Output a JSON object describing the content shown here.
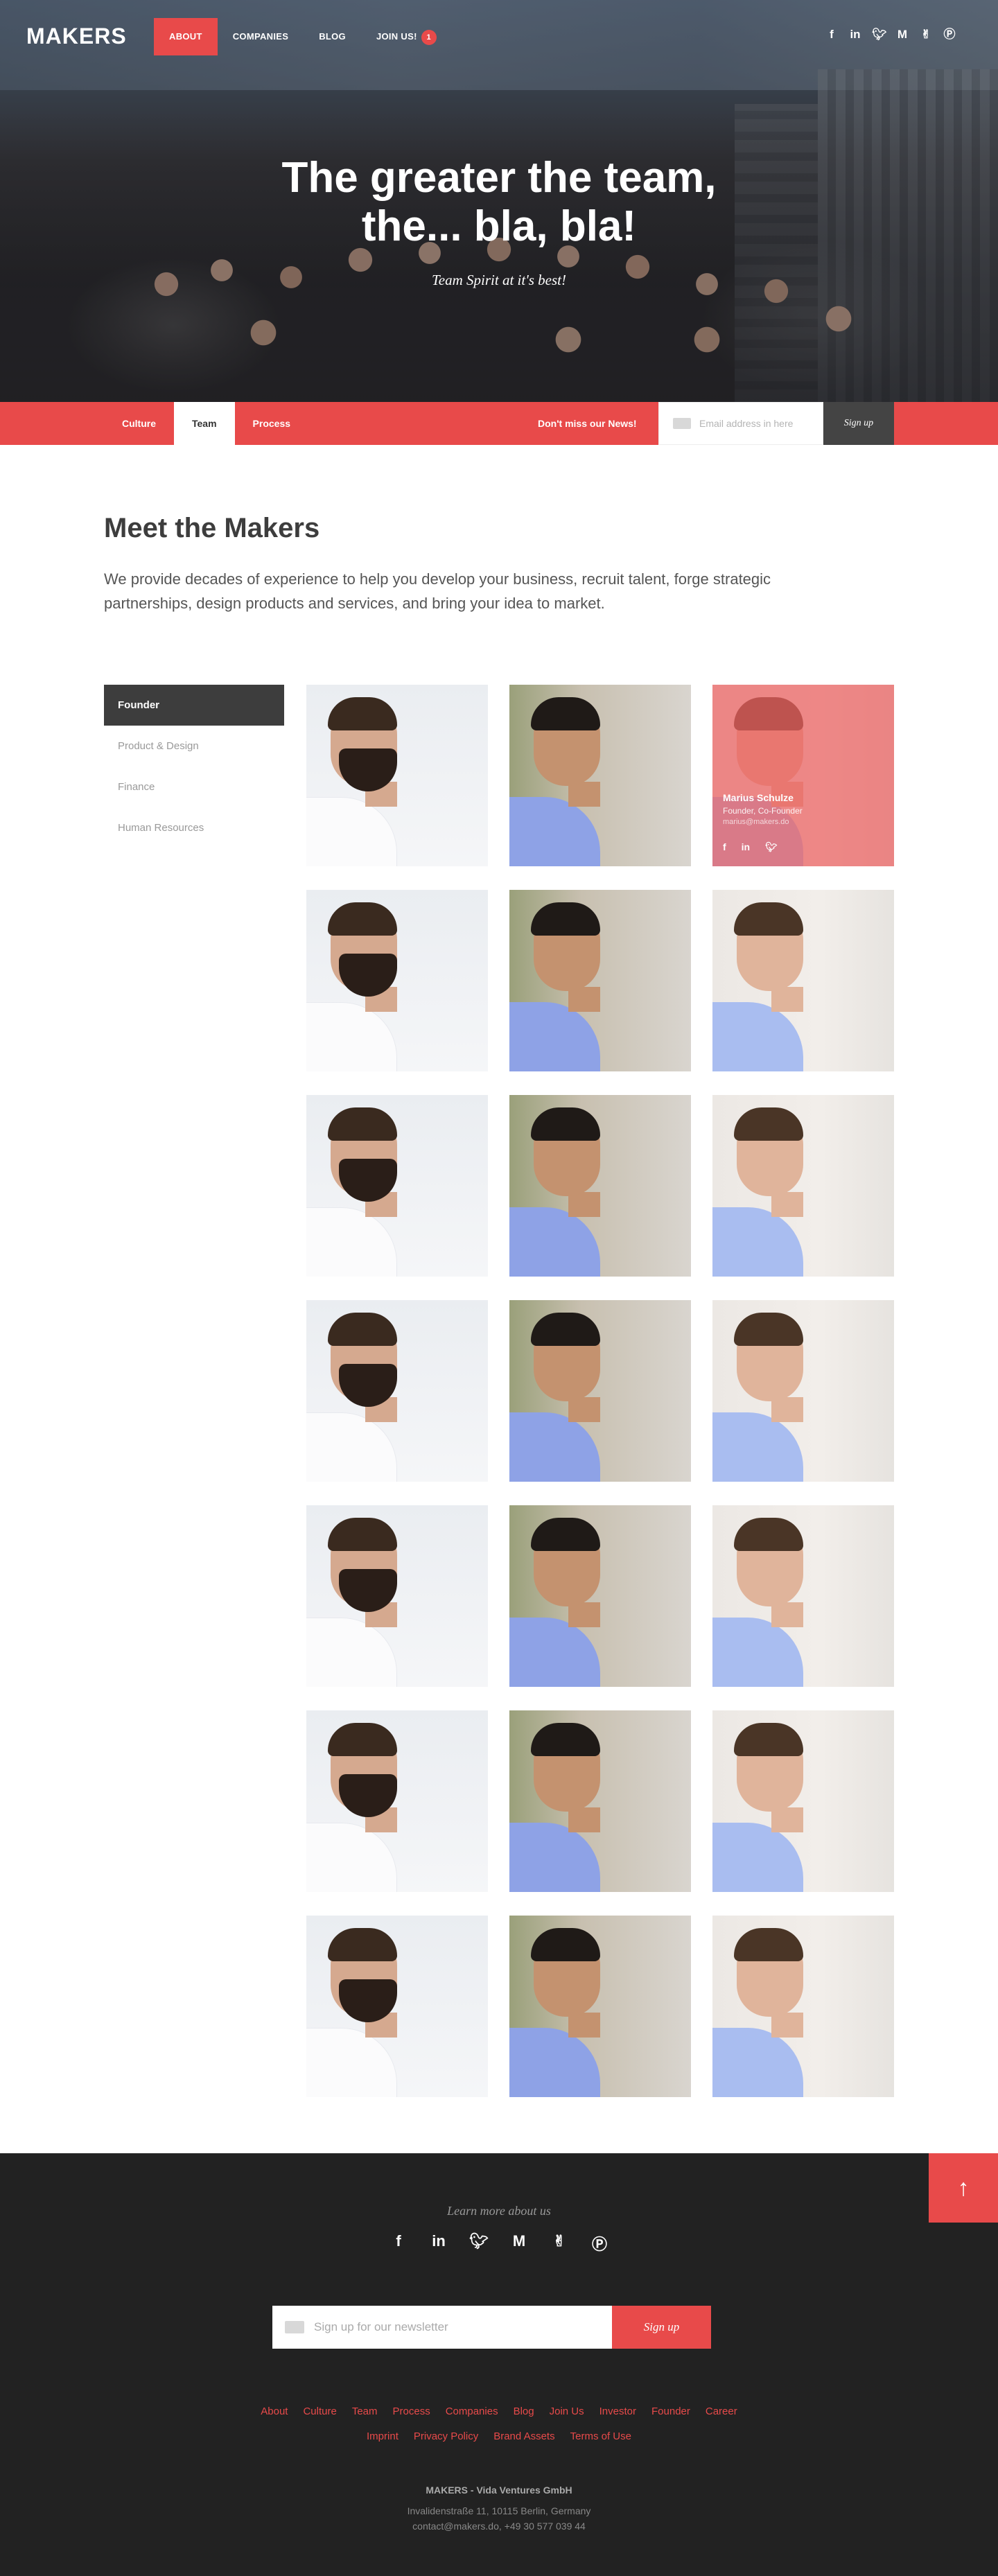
{
  "brand": {
    "logo": "MAKERS",
    "accent": "#e84a4a",
    "dark": "#222222"
  },
  "nav": {
    "items": [
      {
        "label": "ABOUT",
        "active": true
      },
      {
        "label": "COMPANIES"
      },
      {
        "label": "BLOG"
      },
      {
        "label": "JOIN US!"
      }
    ],
    "join_badge": "1",
    "social": [
      "facebook-icon",
      "linkedin-icon",
      "twitter-icon",
      "medium-icon",
      "angellist-icon",
      "producthunt-icon"
    ]
  },
  "hero": {
    "title_line1": "The greater the team,",
    "title_line2": "the... bla, bla!",
    "subtitle": "Team Spirit at it's best!"
  },
  "subnav": {
    "tabs": [
      {
        "label": "Culture"
      },
      {
        "label": "Team",
        "active": true
      },
      {
        "label": "Process"
      }
    ],
    "news_label": "Don't miss our News!",
    "email_placeholder": "Email address in here",
    "signup": "Sign up"
  },
  "meet": {
    "title": "Meet the Makers",
    "description": "We provide decades of experience to help you develop your business, recruit talent, forge strategic partnerships, design products and services, and bring your idea to market."
  },
  "sidebar": {
    "items": [
      {
        "label": "Founder",
        "active": true
      },
      {
        "label": "Product & Design"
      },
      {
        "label": "Finance"
      },
      {
        "label": "Human Resources"
      }
    ]
  },
  "highlight": {
    "name": "Marius Schulze",
    "role": "Founder, Co-Founder",
    "email": "marius@makers.do"
  },
  "team_grid": {
    "rows": 7,
    "columns": 3
  },
  "footer": {
    "learn": "Learn more about us",
    "newsletter_placeholder": "Sign up for our newsletter",
    "newsletter_button": "Sign up",
    "links_row1": [
      "About",
      "Culture",
      "Team",
      "Process",
      "Companies",
      "Blog",
      "Join Us",
      "Investor",
      "Founder",
      "Career"
    ],
    "links_row2": [
      "Imprint",
      "Privacy Policy",
      "Brand Assets",
      "Terms of Use"
    ],
    "company": "MAKERS - Vida Ventures GmbH",
    "address": "Invalidenstraße 11, 10115 Berlin, Germany",
    "contact": "contact@makers.do, +49 30 577 039 44"
  }
}
